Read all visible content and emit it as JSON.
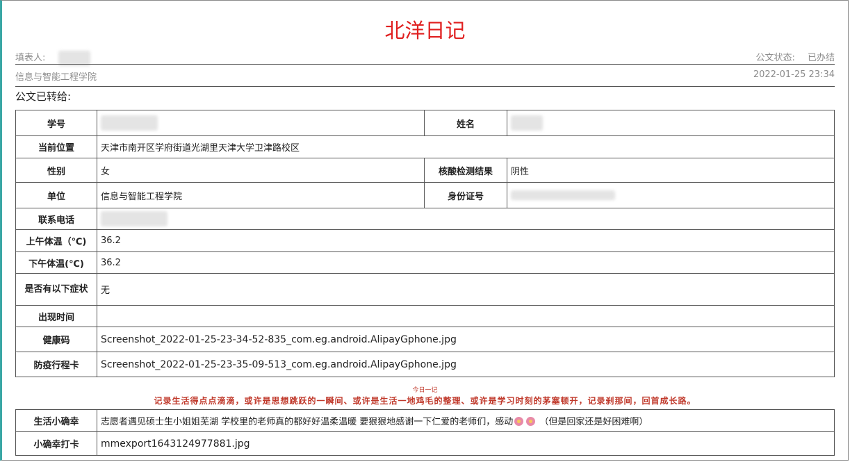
{
  "header": {
    "title": "北洋日记",
    "filler_label": "填表人:",
    "status_label": "公文状态:",
    "status_value": "已办结",
    "department": "信息与智能工程学院",
    "datetime": "2022-01-25 23:34",
    "forwarded_label": "公文已转给:"
  },
  "form": {
    "student_id_label": "学号",
    "name_label": "姓名",
    "location_label": "当前位置",
    "location_value": "天津市南开区学府街道光湖里天津大学卫津路校区",
    "gender_label": "性别",
    "gender_value": "女",
    "nucleic_label": "核酸检测结果",
    "nucleic_value": "阴性",
    "unit_label": "单位",
    "unit_value": "信息与智能工程学院",
    "id_card_label": "身份证号",
    "phone_label": "联系电话",
    "am_temp_label": "上午体温（℃)",
    "am_temp_value": "36.2",
    "pm_temp_label": "下午体温(℃)",
    "pm_temp_value": "36.2",
    "symptoms_label": "是否有以下症状",
    "symptoms_value": "无",
    "onset_label": "出现时间",
    "onset_value": "",
    "health_code_label": "健康码",
    "health_code_file": "Screenshot_2022-01-25-23-34-52-835_com.eg.android.AlipayGphone.jpg",
    "itinerary_label": "防疫行程卡",
    "itinerary_file": "Screenshot_2022-01-25-23-35-09-513_com.eg.android.AlipayGphone.jpg",
    "motto_small": "今日一记",
    "motto": "记录生活得点点滴滴，或许是思想跳跃的一瞬间、或许是生活一地鸡毛的整理、或许是学习时刻的茅塞顿开，记录刹那间，回首成长路。",
    "happiness_label": "生活小确幸",
    "happiness_value": "志愿者遇见硕士生小姐姐芜湖 学校里的老师真的都好好温柔温暖 要狠狠地感谢一下仁爱的老师们，感动",
    "happiness_tail": "（但是回家还是好困难啊）",
    "checkin_label": "小确幸打卡",
    "checkin_file": "mmexport1643124977881.jpg"
  },
  "colors": {
    "title": "#e02020",
    "link": "#3a6fd8",
    "motto": "#c0392b",
    "accent_border": "#3aa7a5"
  }
}
